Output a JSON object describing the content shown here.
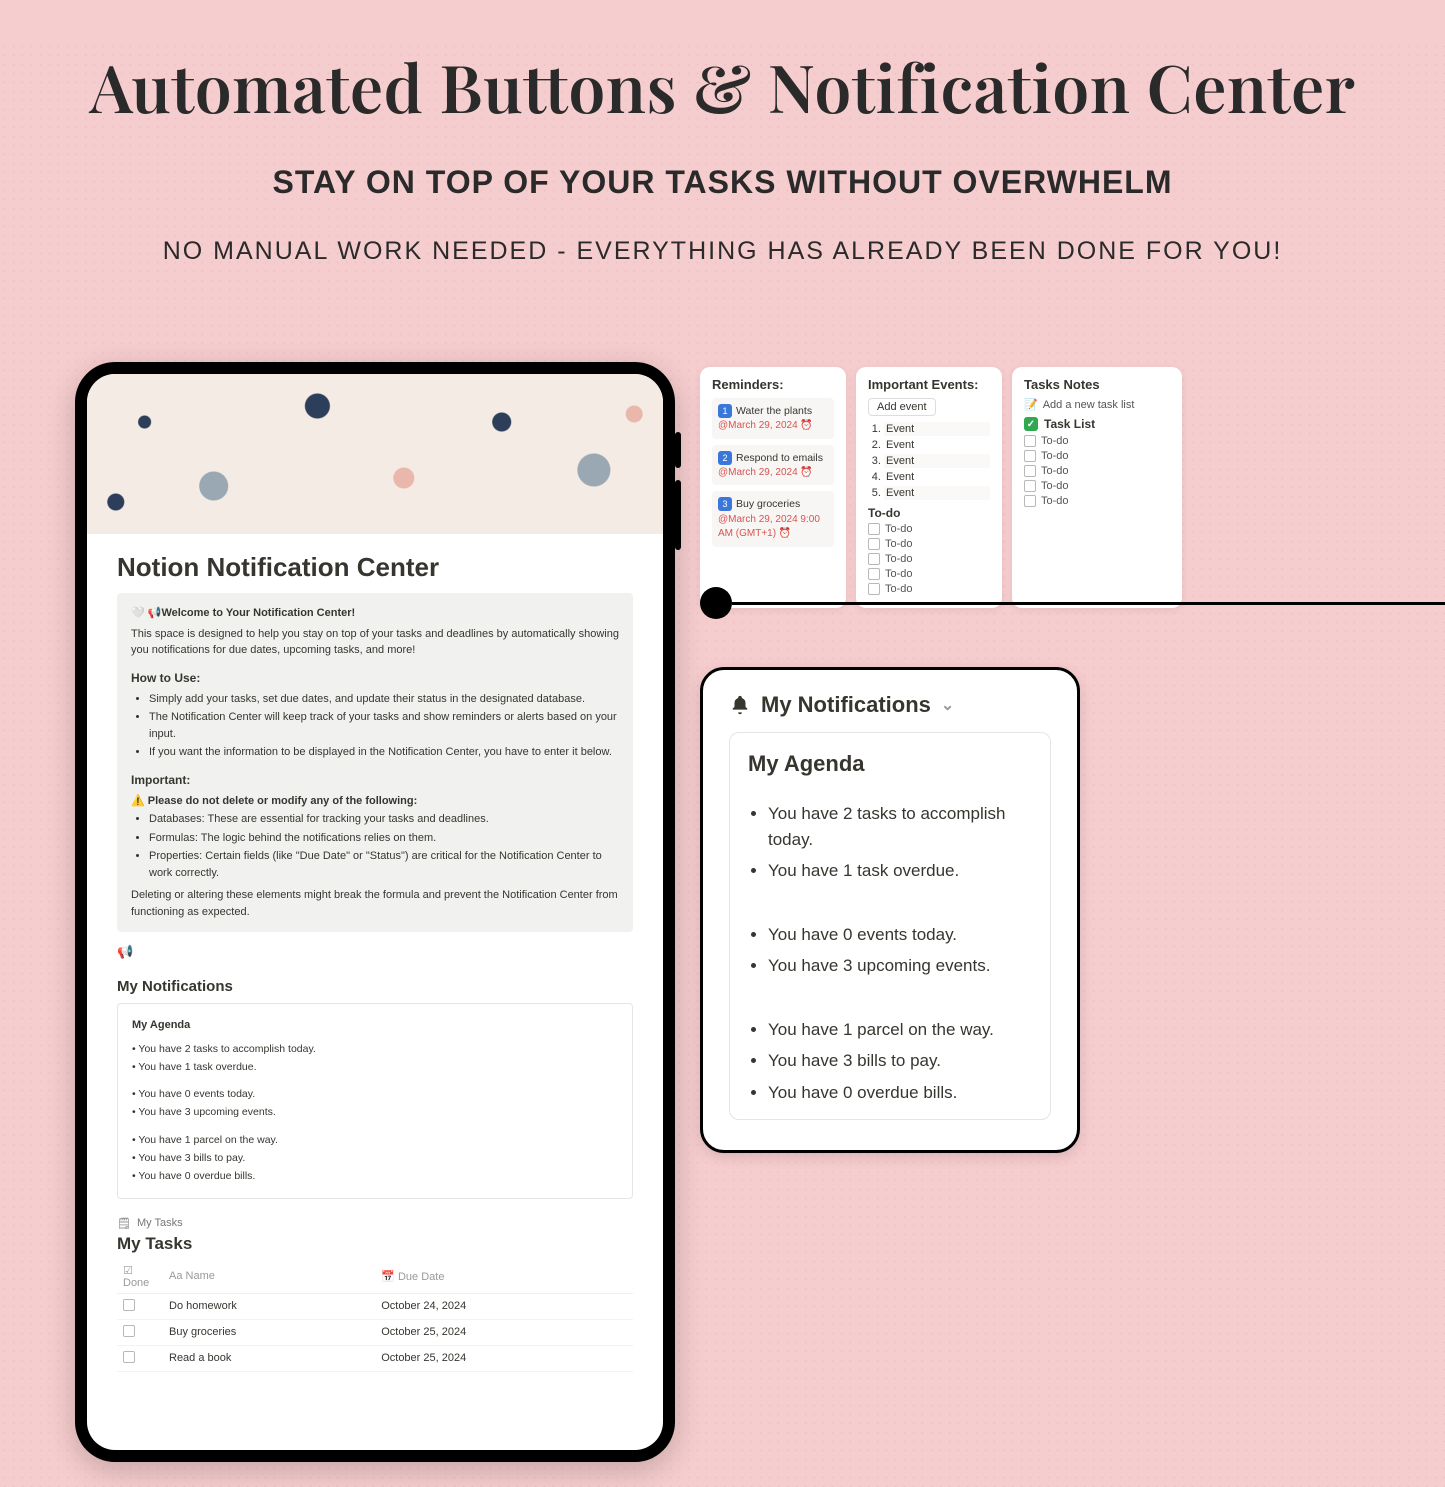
{
  "hero": {
    "title": "Automated Buttons & Notification Center",
    "subtitle": "STAY ON TOP OF YOUR TASKS WITHOUT OVERWHELM",
    "subtext": "NO MANUAL WORK NEEDED - EVERYTHING HAS ALREADY BEEN DONE FOR YOU!"
  },
  "tablet": {
    "pageTitle": "Notion Notification Center",
    "callout": {
      "welcome": "🤍 📢Welcome to Your Notification Center!",
      "intro": "This space is designed to help you stay on top of your tasks and deadlines by automatically showing you notifications for due dates, upcoming tasks, and more!",
      "howHeader": "How to Use:",
      "how": [
        "Simply add your tasks, set due dates, and update their status in the designated database.",
        "The Notification Center will keep track of your tasks and show reminders or alerts based on your input.",
        "If you want the information to be displayed in the Notification Center, you have to enter it below."
      ],
      "importantHeader": "Important:",
      "warn": "⚠️ Please do not delete or modify any of the following:",
      "bullets": [
        "Databases: These are essential for tracking your tasks and deadlines.",
        "Formulas: The logic behind the notifications relies on them.",
        "Properties: Certain fields (like \"Due Date\" or \"Status\") are critical for the Notification Center to work correctly."
      ],
      "outro": "Deleting or altering these elements might break the formula and prevent the Notification Center from functioning as expected."
    },
    "notifHeader": "My Notifications",
    "agenda": {
      "title": "My Agenda",
      "g1": [
        "You have 2 tasks to accomplish today.",
        "You have 1 task overdue."
      ],
      "g2": [
        "You have 0 events today.",
        "You have 3 upcoming events."
      ],
      "g3": [
        "You have 1 parcel on the way.",
        "You have 3 bills to pay.",
        "You have 0 overdue bills."
      ]
    },
    "myTasksLabel": "My Tasks",
    "myTasksTitle": "My Tasks",
    "cols": {
      "done": "Done",
      "name": "Name",
      "due": "Due Date"
    },
    "rows": [
      {
        "name": "Do homework",
        "due": "October 24, 2024"
      },
      {
        "name": "Buy groceries",
        "due": "October 25, 2024"
      },
      {
        "name": "Read a book",
        "due": "October 25, 2024"
      }
    ]
  },
  "widgets": {
    "reminders": {
      "title": "Reminders:",
      "items": [
        {
          "n": "1",
          "text": "Water the plants",
          "date": "@March 29, 2024 ⏰"
        },
        {
          "n": "2",
          "text": "Respond to emails",
          "date": "@March 29, 2024 ⏰"
        },
        {
          "n": "3",
          "text": "Buy groceries",
          "date": "@March 29, 2024 9:00 AM (GMT+1) ⏰"
        }
      ]
    },
    "events": {
      "title": "Important Events:",
      "addLabel": "Add event",
      "items": [
        "Event",
        "Event",
        "Event",
        "Event",
        "Event"
      ],
      "todoHeader": "To-do",
      "todos": [
        "To-do",
        "To-do",
        "To-do",
        "To-do",
        "To-do"
      ]
    },
    "notes": {
      "title": "Tasks Notes",
      "addTask": "Add a new task list",
      "listTitle": "Task List",
      "todos": [
        "To-do",
        "To-do",
        "To-do",
        "To-do",
        "To-do"
      ]
    }
  },
  "bigcard": {
    "header": "My Notifications",
    "agendaTitle": "My Agenda",
    "g1": [
      "You have 2 tasks to accomplish today.",
      "You have 1 task overdue."
    ],
    "g2": [
      "You have 0 events today.",
      "You have 3 upcoming events."
    ],
    "g3": [
      "You have 1 parcel on the way.",
      "You have 3 bills to pay.",
      "You have 0 overdue bills."
    ]
  }
}
